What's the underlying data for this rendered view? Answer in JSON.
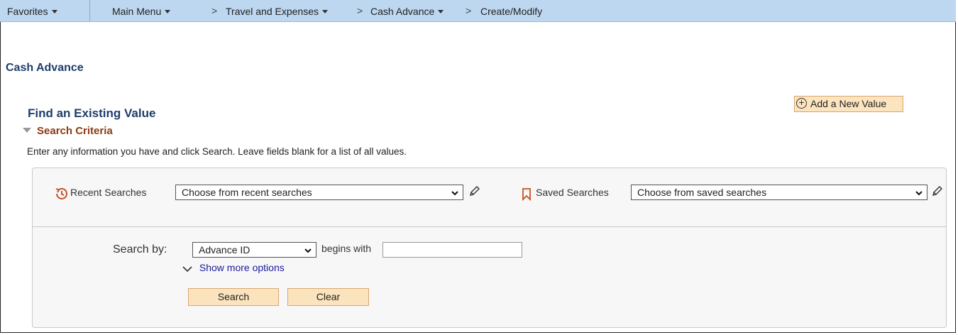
{
  "nav": {
    "favorites": "Favorites",
    "main_menu": "Main Menu",
    "breadcrumb_sep": ">",
    "travel": "Travel and Expenses",
    "cash_advance": "Cash Advance",
    "create_modify": "Create/Modify"
  },
  "page": {
    "title": "Cash Advance",
    "find_title": "Find an Existing Value",
    "add_new_label": "Add a New Value",
    "criteria_label": "Search Criteria",
    "instructions": "Enter any information you have and click Search. Leave fields blank for a list of all values."
  },
  "recent": {
    "label": "Recent Searches",
    "value": "Choose from recent searches"
  },
  "saved": {
    "label": "Saved Searches",
    "value": "Choose from saved searches"
  },
  "search": {
    "by_label": "Search by:",
    "field_value": "Advance ID",
    "operator": "begins with",
    "input_value": "",
    "more_options": "Show more options",
    "search_button": "Search",
    "clear_button": "Clear"
  },
  "colors": {
    "nav_bg": "#bcd7ef",
    "title_blue": "#1f3e6b",
    "criteria_brown": "#8b3b12",
    "button_bg": "#fbe3bd",
    "bookmark_red": "#c8502a"
  },
  "icons": [
    "caret-down-icon",
    "plus-circle-icon",
    "history-icon",
    "bookmark-icon",
    "pencil-icon",
    "chevron-down-icon"
  ]
}
